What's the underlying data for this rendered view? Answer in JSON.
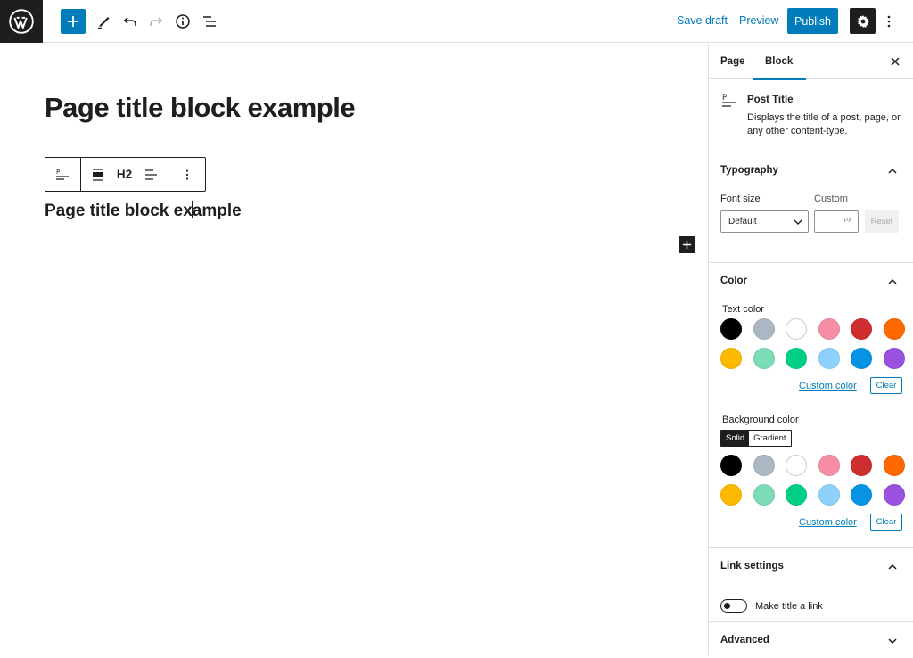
{
  "toolbar": {
    "save_draft": "Save draft",
    "preview": "Preview",
    "publish": "Publish"
  },
  "editor": {
    "page_title": "Page title block example",
    "block_toolbar": {
      "heading_level": "H2"
    },
    "post_title_before_caret": "Page title block ex",
    "post_title_after_caret": "ample"
  },
  "sidebar": {
    "tabs": [
      "Page",
      "Block"
    ],
    "active_tab": "Block",
    "block_card": {
      "title": "Post Title",
      "description": "Displays the title of a post, page, or any other content-type."
    },
    "typography": {
      "title": "Typography",
      "font_size_label": "Font size",
      "custom_label": "Custom",
      "font_size_value": "Default",
      "unit": "PX",
      "reset_label": "Reset"
    },
    "color": {
      "title": "Color",
      "text_color_label": "Text color",
      "background_color_label": "Background color",
      "custom_color_link": "Custom color",
      "clear_label": "Clear",
      "solid_label": "Solid",
      "gradient_label": "Gradient",
      "palette": [
        "#000000",
        "#abb8c3",
        "#ffffff",
        "#f78da7",
        "#cf2e2e",
        "#ff6900",
        "#fcb900",
        "#7bdcb5",
        "#00d084",
        "#8ed1fc",
        "#0693e3",
        "#9b51e0"
      ]
    },
    "link_settings": {
      "title": "Link settings",
      "toggle_label": "Make title a link"
    },
    "advanced": {
      "title": "Advanced"
    }
  },
  "colors": {
    "accent": "#007cba",
    "dark": "#1e1e1e"
  }
}
